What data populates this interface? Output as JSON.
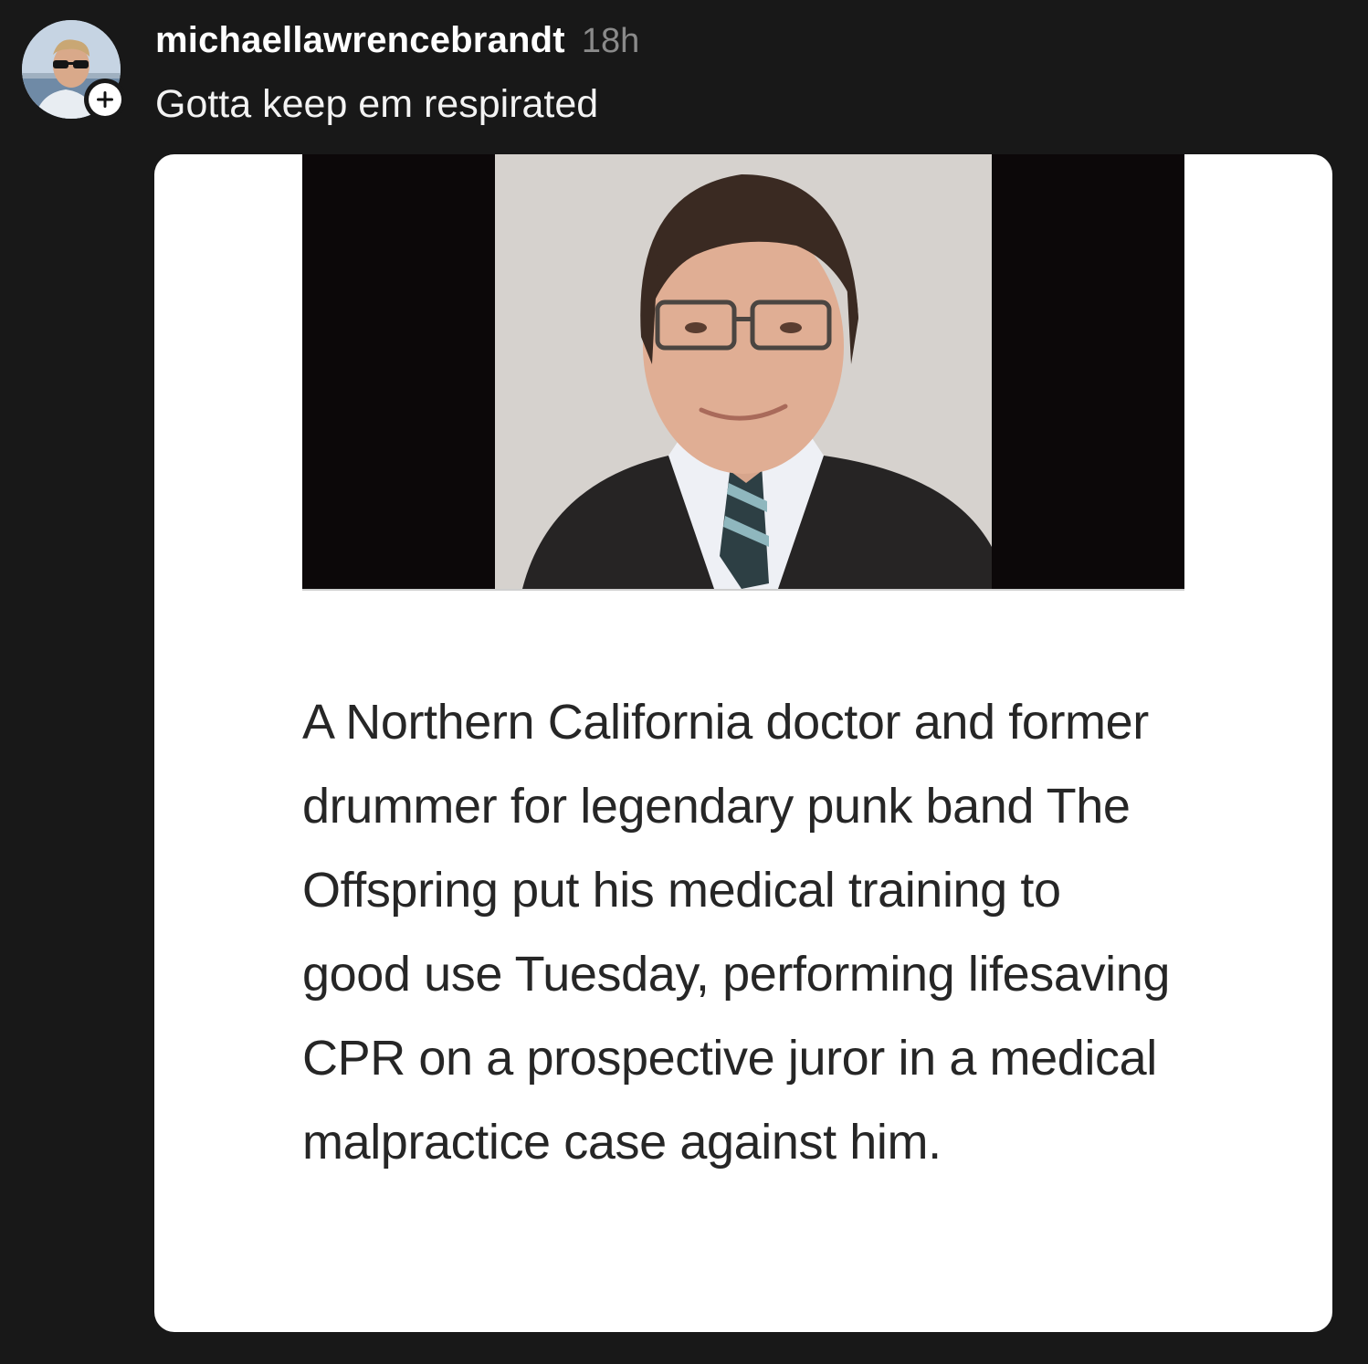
{
  "post": {
    "username": "michaellawrencebrandt",
    "timestamp": "18h",
    "caption": "Gotta keep em respirated",
    "follow_badge_symbol": "+"
  },
  "media": {
    "article_text": "A Northern California doctor and former drummer for legendary punk band The Offspring put his medical training to good use Tuesday, performing lifesaving CPR on a prospective juror in a medical malpractice case against him."
  },
  "colors": {
    "background": "#181818",
    "username": "#ffffff",
    "timestamp": "#8a8a8a",
    "card": "#ffffff",
    "article_text": "#262626"
  }
}
